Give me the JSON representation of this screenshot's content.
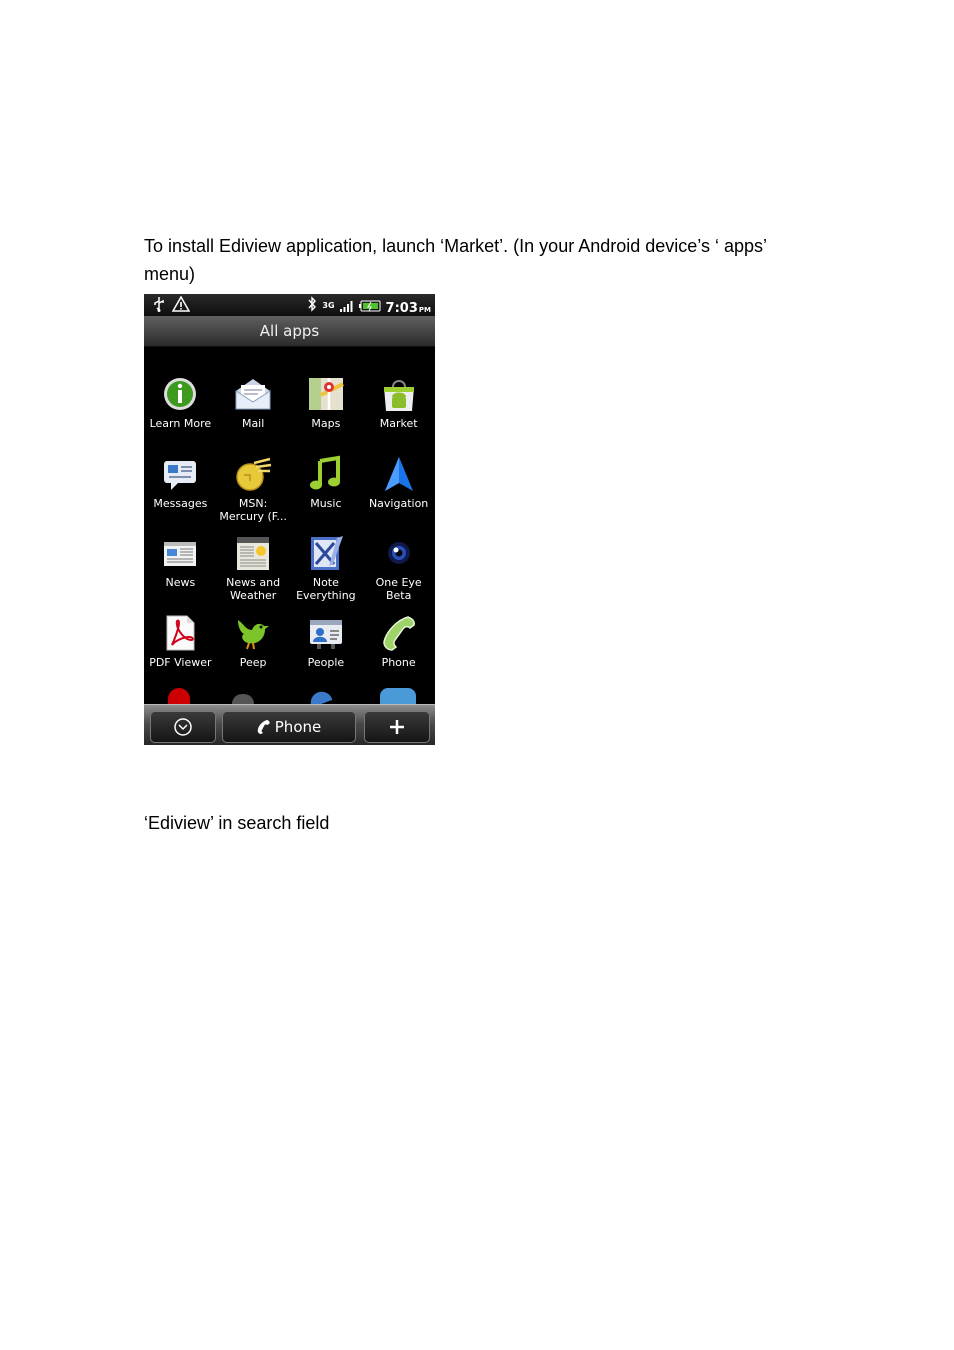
{
  "instructions": {
    "step1": "To install Ediview application, launch ‘Market’. (In your Android device’s ‘ apps’ menu)",
    "step2": "‘Ediview’ in search field"
  },
  "phone": {
    "status": {
      "time": "7:03",
      "ampm": "PM",
      "network": "3G"
    },
    "title": "All apps",
    "apps": [
      {
        "label": "Learn More",
        "icon": "info-icon"
      },
      {
        "label": "Mail",
        "icon": "mail-icon"
      },
      {
        "label": "Maps",
        "icon": "maps-icon"
      },
      {
        "label": "Market",
        "icon": "market-icon"
      },
      {
        "label": "Messages",
        "icon": "messages-icon"
      },
      {
        "label": "MSN:\nMercury (F...",
        "icon": "msn-mercury-icon"
      },
      {
        "label": "Music",
        "icon": "music-icon"
      },
      {
        "label": "Navigation",
        "icon": "navigation-icon"
      },
      {
        "label": "News",
        "icon": "news-icon"
      },
      {
        "label": "News and\nWeather",
        "icon": "news-weather-icon"
      },
      {
        "label": "Note\nEverything",
        "icon": "note-everything-icon"
      },
      {
        "label": "One Eye\nBeta",
        "icon": "one-eye-icon"
      },
      {
        "label": "PDF Viewer",
        "icon": "pdf-icon"
      },
      {
        "label": "Peep",
        "icon": "peep-bird-icon"
      },
      {
        "label": "People",
        "icon": "people-icon"
      },
      {
        "label": "Phone",
        "icon": "phone-handset-icon"
      }
    ],
    "dock": {
      "phone_label": "Phone"
    }
  }
}
